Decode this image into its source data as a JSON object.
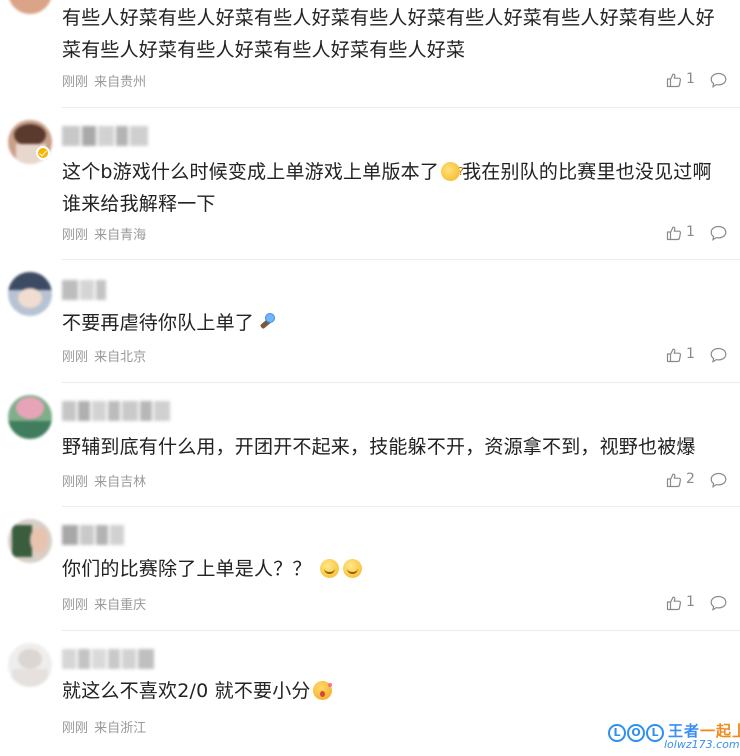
{
  "comments": [
    {
      "text": "有些人好菜有些人好菜有些人好菜有些人好菜有些人好菜有些人好菜有些人好菜有些人好菜有些人好菜有些人好菜有些人好菜",
      "time": "刚刚",
      "location": "来自贵州",
      "likes": "1"
    },
    {
      "text_before": "这个b游戏什么时候变成上单游戏上单版本了",
      "emoji": "thinking-face",
      "text_after": "我在别队的比赛里也没见过啊谁来给我解释一下",
      "time": "刚刚",
      "location": "来自青海",
      "likes": "1",
      "verified": true
    },
    {
      "text": "不要再虐待你队上单了",
      "emoji": "torch",
      "time": "刚刚",
      "location": "来自北京",
      "likes": "1"
    },
    {
      "text": "野辅到底有什么用，开团开不起来，技能躲不开，资源拿不到，视野也被爆",
      "time": "刚刚",
      "location": "来自吉林",
      "likes": "2"
    },
    {
      "text": "你们的比赛除了上单是人？？",
      "emoji": "smile",
      "time": "刚刚",
      "location": "来自重庆",
      "likes": "1"
    },
    {
      "text": "就这么不喜欢2/0 就不要小分",
      "emoji": "surprised-blush",
      "time": "刚刚",
      "location": "来自浙江"
    }
  ],
  "watermark": {
    "letters": [
      "L",
      "O",
      "L"
    ],
    "brand_main": "王者",
    "brand_accent": "一起上",
    "url": "lolwz173.com"
  },
  "colors": {
    "meta_text": "#999999",
    "separator": "#ececec",
    "watermark_blue": "#3b8ef2",
    "watermark_orange": "#f08a1d",
    "verified_badge": "#f7b500"
  }
}
